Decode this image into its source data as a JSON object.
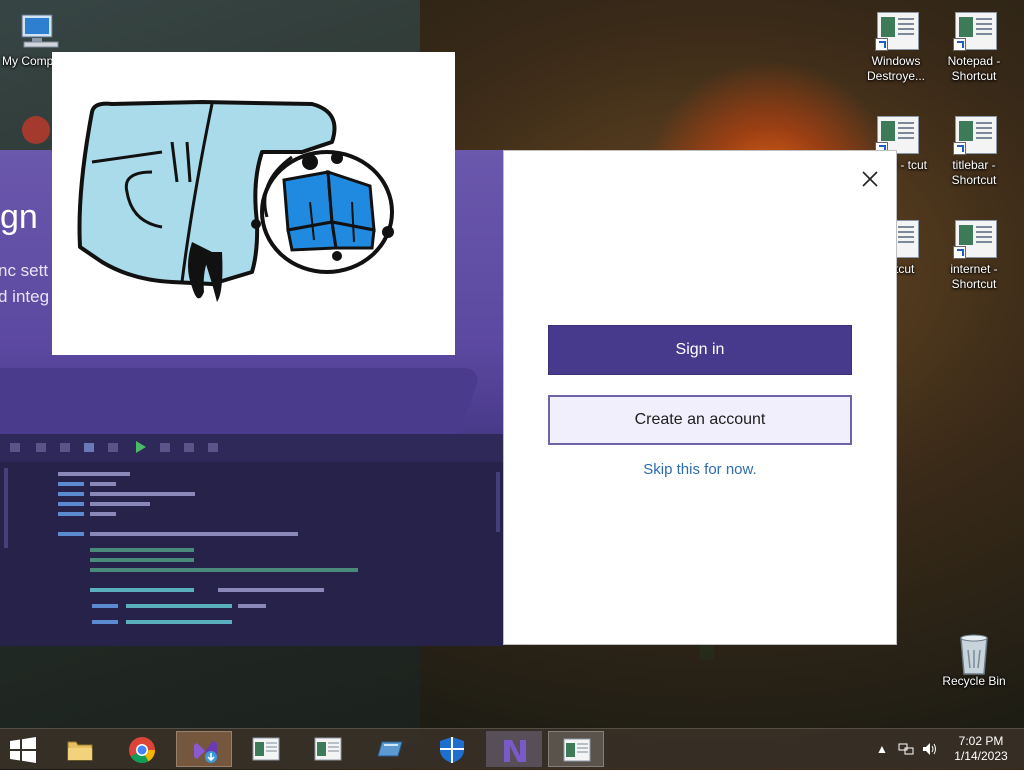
{
  "desktop": {
    "icons": [
      {
        "label": "My Comp"
      },
      {
        "label": "Windows Destroye..."
      },
      {
        "label": "Notepad - Shortcut"
      },
      {
        "label": "STER - tcut"
      },
      {
        "label": "titlebar - Shortcut"
      },
      {
        "label": "n - tcut"
      },
      {
        "label": "internet - Shortcut"
      },
      {
        "label": "Recycle Bin"
      }
    ]
  },
  "dialog": {
    "left": {
      "title": "gn",
      "description_line1": "nc sett",
      "description_line2": "d integ"
    },
    "right": {
      "sign_in_label": "Sign in",
      "create_account_label": "Create an account",
      "skip_label": "Skip this for now."
    }
  },
  "taskbar": {
    "items": [
      {
        "icon": "file-explorer-icon"
      },
      {
        "icon": "chrome-icon"
      },
      {
        "icon": "visual-studio-installer-icon"
      },
      {
        "icon": "window-app-icon"
      },
      {
        "icon": "window-app-icon"
      },
      {
        "icon": "drive-icon"
      },
      {
        "icon": "defender-shield-icon"
      },
      {
        "icon": "visual-studio-icon"
      },
      {
        "icon": "window-app-icon"
      }
    ],
    "time": "7:02 PM",
    "date": "1/14/2023"
  },
  "colors": {
    "accent_purple": "#473a8c",
    "link_blue": "#2d6cb0",
    "paint_blue": "#a9dbea",
    "logo_blue": "#1f8ae0"
  }
}
